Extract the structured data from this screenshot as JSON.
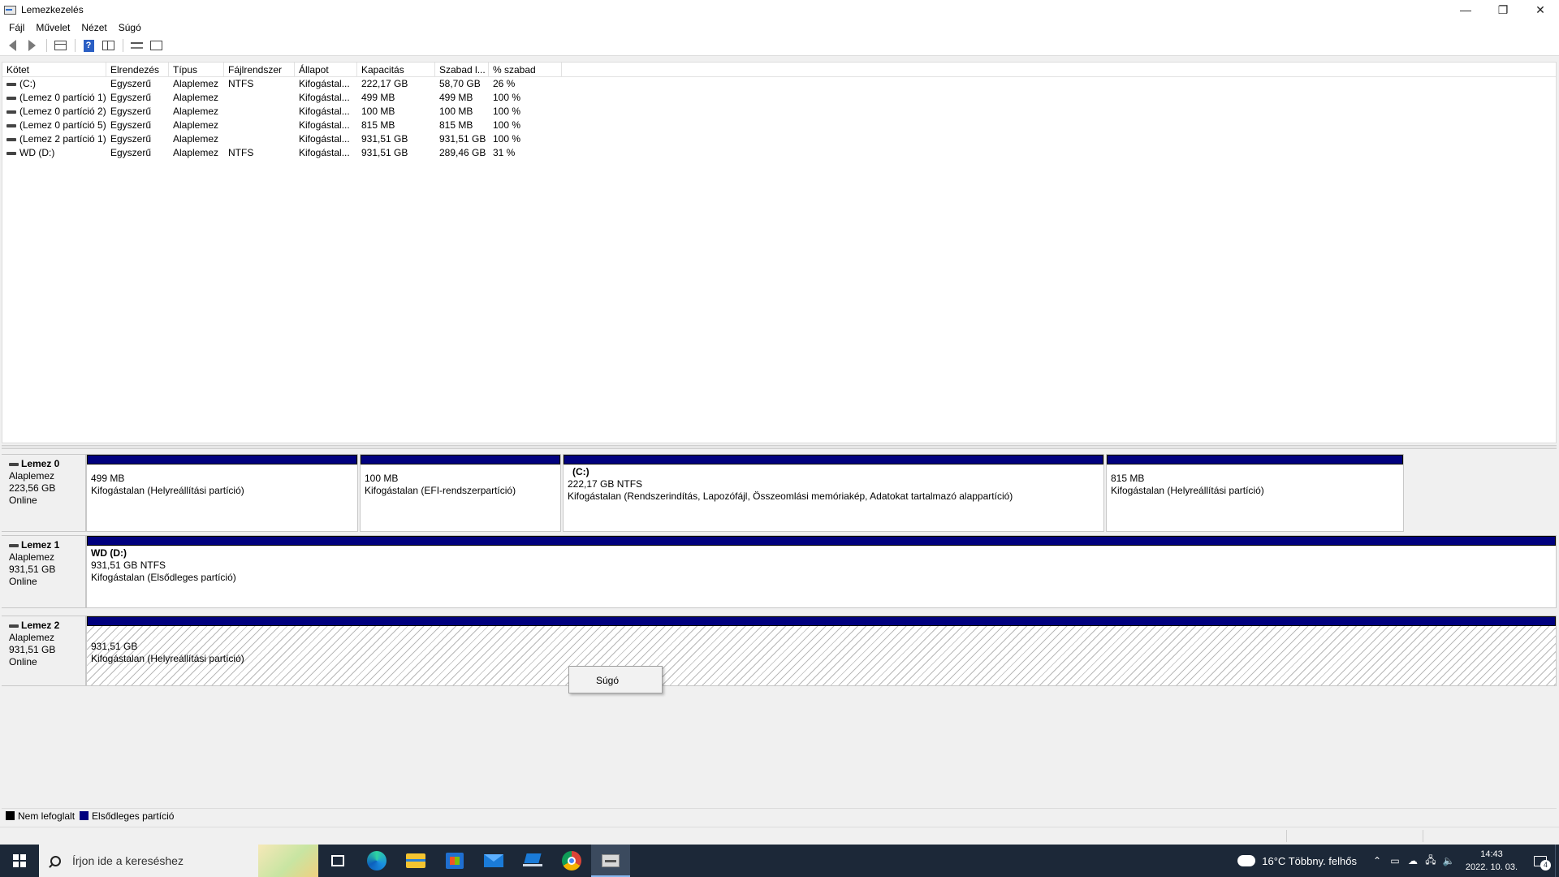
{
  "window": {
    "title": "Lemezkezelés",
    "controls": {
      "minimize": "—",
      "restore": "❐",
      "close": "✕"
    }
  },
  "menu": [
    "Fájl",
    "Művelet",
    "Nézet",
    "Súgó"
  ],
  "toolbar": {
    "icons": [
      "back-icon",
      "forward-icon",
      "list-view-icon",
      "help-icon",
      "panel-view-icon",
      "rescan-icon",
      "properties-icon"
    ]
  },
  "volume_list": {
    "columns": [
      "Kötet",
      "Elrendezés",
      "Típus",
      "Fájlrendszer",
      "Állapot",
      "Kapacitás",
      "Szabad l...",
      "% szabad"
    ],
    "rows": [
      [
        "(C:)",
        "Egyszerű",
        "Alaplemez",
        "NTFS",
        "Kifogástal...",
        "222,17 GB",
        "58,70 GB",
        "26 %"
      ],
      [
        "(Lemez 0 partíció 1)",
        "Egyszerű",
        "Alaplemez",
        "",
        "Kifogástal...",
        "499 MB",
        "499 MB",
        "100 %"
      ],
      [
        "(Lemez 0 partíció 2)",
        "Egyszerű",
        "Alaplemez",
        "",
        "Kifogástal...",
        "100 MB",
        "100 MB",
        "100 %"
      ],
      [
        "(Lemez 0 partíció 5)",
        "Egyszerű",
        "Alaplemez",
        "",
        "Kifogástal...",
        "815 MB",
        "815 MB",
        "100 %"
      ],
      [
        "(Lemez 2 partíció 1)",
        "Egyszerű",
        "Alaplemez",
        "",
        "Kifogástal...",
        "931,51 GB",
        "931,51 GB",
        "100 %"
      ],
      [
        "WD (D:)",
        "Egyszerű",
        "Alaplemez",
        "NTFS",
        "Kifogástal...",
        "931,51 GB",
        "289,46 GB",
        "31 %"
      ]
    ]
  },
  "disks": [
    {
      "name": "Lemez 0",
      "type": "Alaplemez",
      "size": "223,56 GB",
      "status": "Online",
      "partitions": [
        {
          "volume": "",
          "size": "499 MB",
          "status": "Kifogástalan (Helyreállítási partíció)"
        },
        {
          "volume": "",
          "size": "100 MB",
          "status": "Kifogástalan (EFI-rendszerpartíció)"
        },
        {
          "volume": "(C:)",
          "size": "222,17 GB NTFS",
          "status": "Kifogástalan (Rendszerindítás, Lapozófájl, Összeomlási memóriakép, Adatokat tartalmazó alappartíció)"
        },
        {
          "volume": "",
          "size": "815 MB",
          "status": "Kifogástalan (Helyreállítási partíció)"
        }
      ]
    },
    {
      "name": "Lemez 1",
      "type": "Alaplemez",
      "size": "931,51 GB",
      "status": "Online",
      "partitions": [
        {
          "volume": "WD  (D:)",
          "size": "931,51 GB NTFS",
          "status": "Kifogástalan (Elsődleges partíció)"
        }
      ]
    },
    {
      "name": "Lemez 2",
      "type": "Alaplemez",
      "size": "931,51 GB",
      "status": "Online",
      "partitions": [
        {
          "volume": "",
          "size": "931,51 GB",
          "status": "Kifogástalan (Helyreállítási partíció)"
        }
      ]
    }
  ],
  "context_menu": {
    "items": [
      "Súgó"
    ]
  },
  "legend": [
    {
      "label": "Nem lefoglalt",
      "color": "#000000"
    },
    {
      "label": "Elsődleges partíció",
      "color": "#00007e"
    }
  ],
  "taskbar": {
    "search_placeholder": "Írjon ide a kereséshez",
    "apps": [
      "task-view-icon",
      "edge-icon",
      "file-explorer-icon",
      "store-icon",
      "mail-icon",
      "laptop-app-icon",
      "chrome-icon",
      "disk-management-icon"
    ],
    "weather": "16°C  Többny. felhős",
    "time": "14:43",
    "date": "2022. 10. 03.",
    "notification_count": "4"
  },
  "colors": {
    "partition_bar": "#00007e",
    "taskbar": "#1c2838"
  }
}
